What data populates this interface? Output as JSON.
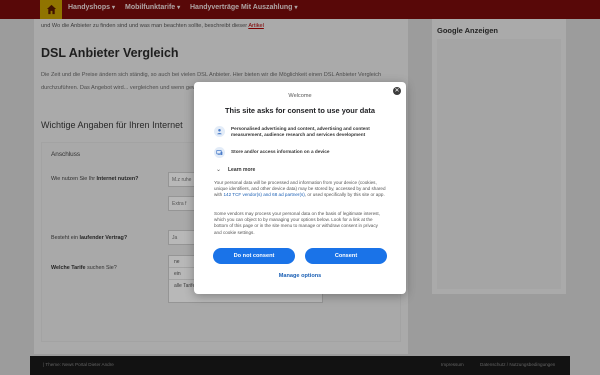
{
  "nav": {
    "items": [
      {
        "label": "Handyshops"
      },
      {
        "label": "Mobilfunktarife"
      },
      {
        "label": "Handyverträge Mit Auszahlung"
      }
    ]
  },
  "main": {
    "intro_text": "und Wo die Anbieter zu finden sind und was man beachten sollte, beschreibt dieser",
    "intro_link": "Artikel",
    "title": "DSL Anbieter Vergleich",
    "paragraph": "Die Zeit und die Preise ändern sich ständig, so auch bei vielen DSL Anbieter. Hier bieten wir die Möglichkeit einen DSL Anbieter Vergleich durchzuführen. Das Angebot wird... vergleichen und wenn gewünscht gleich wechseln.",
    "subtitle": "Wichtige Angaben für Ihren Internet",
    "form": {
      "legend": "Anschluss",
      "q1_pre": "Wie nutzen Sie Ihr",
      "q1_bold": "Internet nutzen?",
      "input1_value": "M.z ruhe",
      "input2_value": "Extra f",
      "q2_pre": "Besteht ein",
      "q2_bold": "laufender Vertrag?",
      "q2_value": "Ja",
      "q3_bold": "Welche Tarife",
      "q3_post": "suchen Sie?",
      "radios": [
        "ne",
        "ein",
        "alle Tarife"
      ]
    }
  },
  "sidebar": {
    "title": "Google Anzeigen"
  },
  "footer": {
    "left": "| Theme: News Portal Dieter Andre",
    "right_a": "Impressum",
    "right_b": "Datenschutz / Nutzungsbedingungen"
  },
  "consent": {
    "welcome": "Welcome",
    "title": "This site asks for consent to use your data",
    "purposes": [
      {
        "icon": "person-icon",
        "text": "Personalised advertising and content, advertising and content measurement, audience research and services development"
      },
      {
        "icon": "device-icon",
        "text": "Store and/or access information on a device"
      }
    ],
    "learn_more": "Learn more",
    "body1_pre": "Your personal data will be processed and information from your device (cookies, unique identifiers, and other device data) may be stored by, accessed by and shared with",
    "body1_link": "142 TCF vendor(s) and 68 ad partner(s)",
    "body1_post": ", or used specifically by this site or app.",
    "body2": "Some vendors may process your personal data on the basis of legitimate interest, which you can object to by managing your options below. Look for a link at the bottom of this page or in the site menu to manage or withdraw consent in privacy and cookie settings.",
    "do_not_consent": "Do not consent",
    "consent": "Consent",
    "manage": "Manage options"
  },
  "colors": {
    "nav_bg": "#7a0c0c",
    "home_bg": "#c8a100",
    "button_blue": "#1a73e8",
    "link_blue": "#1a5fb4"
  }
}
